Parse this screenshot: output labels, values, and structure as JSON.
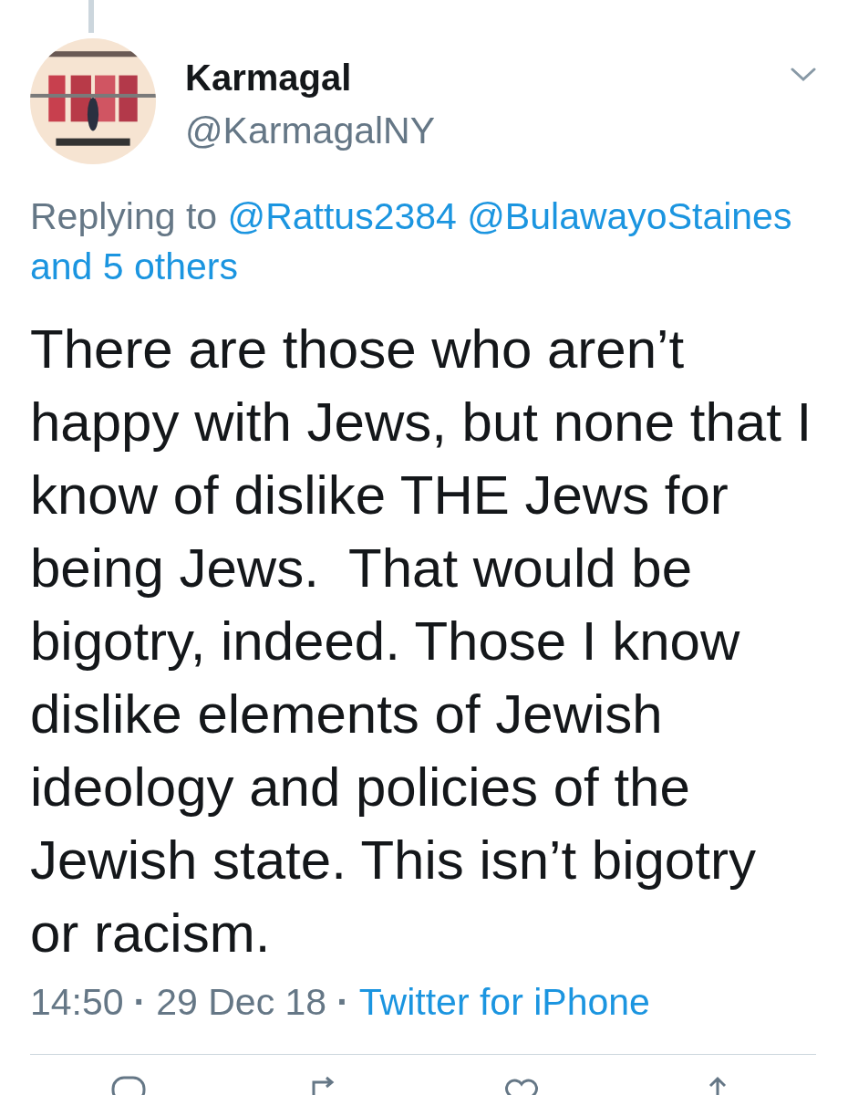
{
  "author": {
    "name": "Karmagal",
    "handle": "@KarmagalNY"
  },
  "reply": {
    "prefix": "Replying to",
    "mentions": [
      "@Rattus2384",
      "@BulawayoStaines"
    ],
    "others": "and 5 others"
  },
  "text": "There are those who aren’t happy with Jews, but none that I know of dislike THE Jews for being Jews.  That would be bigotry, indeed. Those I know dislike elements of Jewish ideology and policies of the Jewish state. This isn’t bigotry or racism.",
  "meta": {
    "time": "14:50",
    "separator_1": "·",
    "date": "29 Dec 18",
    "separator_2": "·",
    "source": "Twitter for iPhone"
  }
}
